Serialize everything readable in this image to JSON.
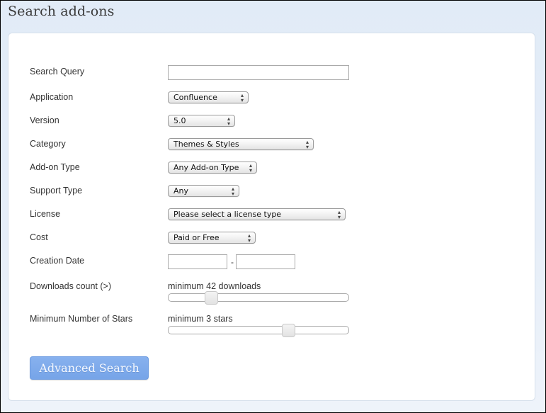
{
  "page": {
    "title": "Search add-ons"
  },
  "form": {
    "search_query": {
      "label": "Search Query",
      "value": "",
      "placeholder": ""
    },
    "application": {
      "label": "Application",
      "selected": "Confluence"
    },
    "version": {
      "label": "Version",
      "selected": "5.0"
    },
    "category": {
      "label": "Category",
      "selected": "Themes & Styles"
    },
    "addon_type": {
      "label": "Add-on Type",
      "selected": "Any Add-on Type"
    },
    "support_type": {
      "label": "Support Type",
      "selected": "Any"
    },
    "license": {
      "label": "License",
      "selected": "Please select a license type"
    },
    "cost": {
      "label": "Cost",
      "selected": "Paid or Free"
    },
    "creation_date": {
      "label": "Creation Date",
      "from_value": "",
      "to_value": "",
      "separator": "-"
    },
    "downloads": {
      "label": "Downloads count (>)",
      "caption": "minimum 42 downloads",
      "value": 42,
      "slider_fraction": 0.24
    },
    "stars": {
      "label": "Minimum Number of Stars",
      "caption": "minimum 3 stars",
      "value": 3,
      "slider_fraction": 0.67
    },
    "submit_label": "Advanced Search"
  },
  "icons": {
    "select_arrows": "▲▼"
  },
  "colors": {
    "button_bg": "#7fabec",
    "page_bg": "#e1ebf7"
  }
}
